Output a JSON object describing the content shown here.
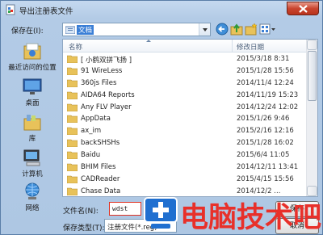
{
  "window": {
    "title": "导出注册表文件"
  },
  "save_in": {
    "label": "保存在(I):",
    "value": "文档"
  },
  "places": [
    {
      "label": "最近访问的位置",
      "icon": "recent-places-icon"
    },
    {
      "label": "桌面",
      "icon": "desktop-icon"
    },
    {
      "label": "库",
      "icon": "libraries-icon"
    },
    {
      "label": "计算机",
      "icon": "computer-icon"
    },
    {
      "label": "网络",
      "icon": "network-icon"
    }
  ],
  "list": {
    "columns": {
      "name": "名称",
      "date": "修改日期"
    },
    "items": [
      {
        "name": "[ 小鹤双拼飞扬 ]",
        "date": "2015/3/18 8:31"
      },
      {
        "name": "91 WireLess",
        "date": "2015/1/28 15:56"
      },
      {
        "name": "360js Files",
        "date": "2014/11/4 12:24"
      },
      {
        "name": "AIDA64 Reports",
        "date": "2014/11/19 15:23"
      },
      {
        "name": "Any FLV Player",
        "date": "2014/12/24 12:02"
      },
      {
        "name": "AppData",
        "date": "2015/1/26 9:46"
      },
      {
        "name": "ax_im",
        "date": "2015/2/16 12:16"
      },
      {
        "name": "backSHSHs",
        "date": "2015/1/28 16:02"
      },
      {
        "name": "Baidu",
        "date": "2015/6/4 11:05"
      },
      {
        "name": "BHIM Files",
        "date": "2014/12/11 13:41"
      },
      {
        "name": "CADReader",
        "date": "2015/4/15 15:56"
      },
      {
        "name": "Chase Data",
        "date": "2014/12/2 ..."
      }
    ]
  },
  "filename": {
    "label": "文件名(N):",
    "value": "wdst"
  },
  "filetype": {
    "label": "保存类型(T):",
    "value": "注册文件(*.reg)"
  },
  "buttons": {
    "save": "保存",
    "cancel": "取消"
  },
  "watermark": {
    "text": "电脑技术吧"
  },
  "colors": {
    "accent": "#3b7fd6",
    "folder": "#e8c25a",
    "watermark": "#e8302a",
    "close": "#c9452f"
  }
}
